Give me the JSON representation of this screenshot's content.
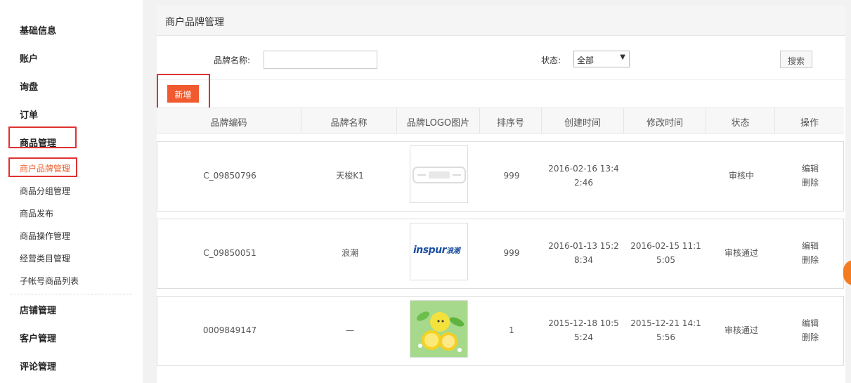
{
  "sidebar": {
    "heads": [
      "基础信息",
      "账户",
      "询盘",
      "订单",
      "商品管理",
      "店铺管理",
      "客户管理",
      "评论管理"
    ],
    "subs": [
      "商户品牌管理",
      "商品分组管理",
      "商品发布",
      "商品操作管理",
      "经营类目管理",
      "子帐号商品列表"
    ]
  },
  "main": {
    "title": "商户品牌管理",
    "filter": {
      "name_label": "品牌名称:",
      "name_value": "",
      "status_label": "状态:",
      "status_value": "全部",
      "search_label": "搜索"
    },
    "add_label": "新增",
    "columns": [
      "品牌编码",
      "品牌名称",
      "品牌LOGO图片",
      "排序号",
      "创建时间",
      "修改时间",
      "状态",
      "操作"
    ],
    "rows": [
      {
        "code": "C_09850796",
        "name": "天梭K1",
        "logo": "placeholder",
        "sort": "999",
        "created_1": "2016-02-16 13:4",
        "created_2": "2:46",
        "modified_1": "",
        "modified_2": "",
        "status": "审核中",
        "edit": "编辑",
        "delete": "删除"
      },
      {
        "code": "C_09850051",
        "name": "浪潮",
        "logo": "inspur",
        "logo_text": "inspur",
        "logo_cn": "浪潮",
        "sort": "999",
        "created_1": "2016-01-13 15:2",
        "created_2": "8:34",
        "modified_1": "2016-02-15 11:1",
        "modified_2": "5:05",
        "status": "审核通过",
        "edit": "编辑",
        "delete": "删除"
      },
      {
        "code": "0009849147",
        "name": "—",
        "logo": "lemon-image",
        "sort": "1",
        "created_1": "2015-12-18 10:5",
        "created_2": "5:24",
        "modified_1": "2015-12-21 14:1",
        "modified_2": "5:56",
        "status": "审核通过",
        "edit": "编辑",
        "delete": "删除"
      }
    ]
  },
  "colors": {
    "accent": "#f05a2e",
    "highlight_box": "#e03131",
    "active_link": "#f0602e"
  }
}
